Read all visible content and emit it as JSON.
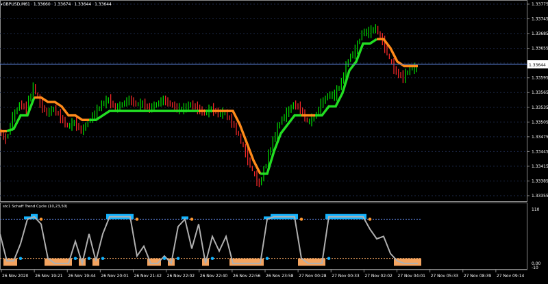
{
  "main_chart": {
    "symbol_tf": "GBPUSD,M61",
    "open": "1.33660",
    "high": "1.33674",
    "low": "1.33644",
    "close": "1.33644",
    "current_price": "1.33644",
    "price_ticks": [
      "1.33775",
      "1.33745",
      "1.33685",
      "1.33655",
      "1.33625",
      "1.33595",
      "1.33565",
      "1.33535",
      "1.33505",
      "1.33475",
      "1.33445",
      "1.33415",
      "1.33385",
      "1.33355"
    ],
    "colors": {
      "bull": "#00e000",
      "bear": "#ff2a2a",
      "trend_up": "#22dd22",
      "trend_down": "#ff8a1a",
      "price_line": "#5a7fd6"
    }
  },
  "indicator": {
    "title": "stc1 Schaff Trend Cycle (10,23,50)",
    "level_labels": [
      "110",
      "0.00",
      "-10"
    ],
    "colors": {
      "high_fill": "#14b4ff",
      "low_fill": "#f4a460",
      "line": "#b0b0b0",
      "dot_blue": "#14b4ff",
      "dot_orange": "#ff9933"
    }
  },
  "time_axis": [
    "26 Nov 2020",
    "26 Nov 19:21",
    "26 Nov 19:44",
    "26 Nov 20:01",
    "26 Nov 21:42",
    "26 Nov 22:02",
    "26 Nov 22:40",
    "26 Nov 22:56",
    "26 Nov 23:58",
    "27 Nov 00:28",
    "27 Nov 00:33",
    "27 Nov 02:02",
    "27 Nov 04:01",
    "27 Nov 05:33",
    "27 Nov 08:39",
    "27 Nov 09:14"
  ],
  "chart_data": [
    {
      "type": "line",
      "title": "GBPUSD,M61",
      "ylim": [
        1.3335,
        1.3378
      ],
      "series": [
        {
          "name": "Close",
          "x": [
            0,
            10,
            20,
            30,
            40,
            50,
            60,
            70,
            80,
            90,
            100,
            110,
            120,
            130,
            140,
            150,
            160,
            170,
            180,
            190,
            200,
            210,
            220,
            230,
            240,
            250,
            260,
            270,
            280,
            290,
            300,
            310,
            320,
            330,
            340,
            350,
            360,
            370,
            380,
            390,
            400,
            410,
            420,
            430,
            440,
            450,
            460,
            470,
            480,
            490,
            500,
            510,
            520,
            530,
            540,
            550,
            560,
            570,
            580,
            590,
            600,
            610
          ],
          "values": [
            1.335,
            1.3348,
            1.3353,
            1.3356,
            1.3355,
            1.336,
            1.3356,
            1.3354,
            1.3355,
            1.3353,
            1.3351,
            1.3352,
            1.335,
            1.3352,
            1.3354,
            1.3356,
            1.3357,
            1.3355,
            1.3356,
            1.3357,
            1.3356,
            1.3356,
            1.3355,
            1.3356,
            1.3357,
            1.3356,
            1.3355,
            1.3355,
            1.3356,
            1.3355,
            1.3354,
            1.3355,
            1.3354,
            1.3354,
            1.3352,
            1.3349,
            1.3345,
            1.3341,
            1.3338,
            1.3343,
            1.3348,
            1.3352,
            1.3354,
            1.3356,
            1.3355,
            1.3352,
            1.3353,
            1.3356,
            1.3358,
            1.3358,
            1.3361,
            1.3366,
            1.3368,
            1.3372,
            1.3372,
            1.3373,
            1.337,
            1.3366,
            1.3363,
            1.3362,
            1.3364,
            1.3364
          ]
        }
      ]
    },
    {
      "type": "area",
      "title": "stc1 Schaff Trend Cycle (10,23,50)",
      "ylim": [
        -10,
        110
      ],
      "series": [
        {
          "name": "STC",
          "x": [
            0,
            10,
            20,
            30,
            40,
            50,
            60,
            70,
            80,
            90,
            100,
            110,
            120,
            130,
            140,
            150,
            160,
            170,
            180,
            190,
            200,
            210,
            220,
            230,
            240,
            250,
            260,
            270,
            280,
            290,
            300,
            310,
            320,
            330,
            340,
            350,
            360,
            370,
            380,
            390,
            400,
            410,
            420,
            430,
            440,
            450,
            460,
            470,
            480,
            490,
            500,
            510,
            520,
            530,
            540,
            550,
            560,
            570,
            580,
            590,
            600,
            610
          ],
          "values": [
            60,
            5,
            5,
            40,
            90,
            95,
            80,
            10,
            0,
            0,
            0,
            45,
            0,
            60,
            5,
            60,
            95,
            95,
            95,
            95,
            15,
            35,
            0,
            0,
            15,
            0,
            75,
            90,
            30,
            80,
            0,
            55,
            25,
            55,
            0,
            0,
            0,
            0,
            0,
            90,
            95,
            95,
            95,
            95,
            10,
            0,
            0,
            0,
            95,
            95,
            95,
            95,
            95,
            95,
            70,
            50,
            55,
            20,
            5,
            0,
            0,
            0
          ]
        }
      ]
    }
  ]
}
